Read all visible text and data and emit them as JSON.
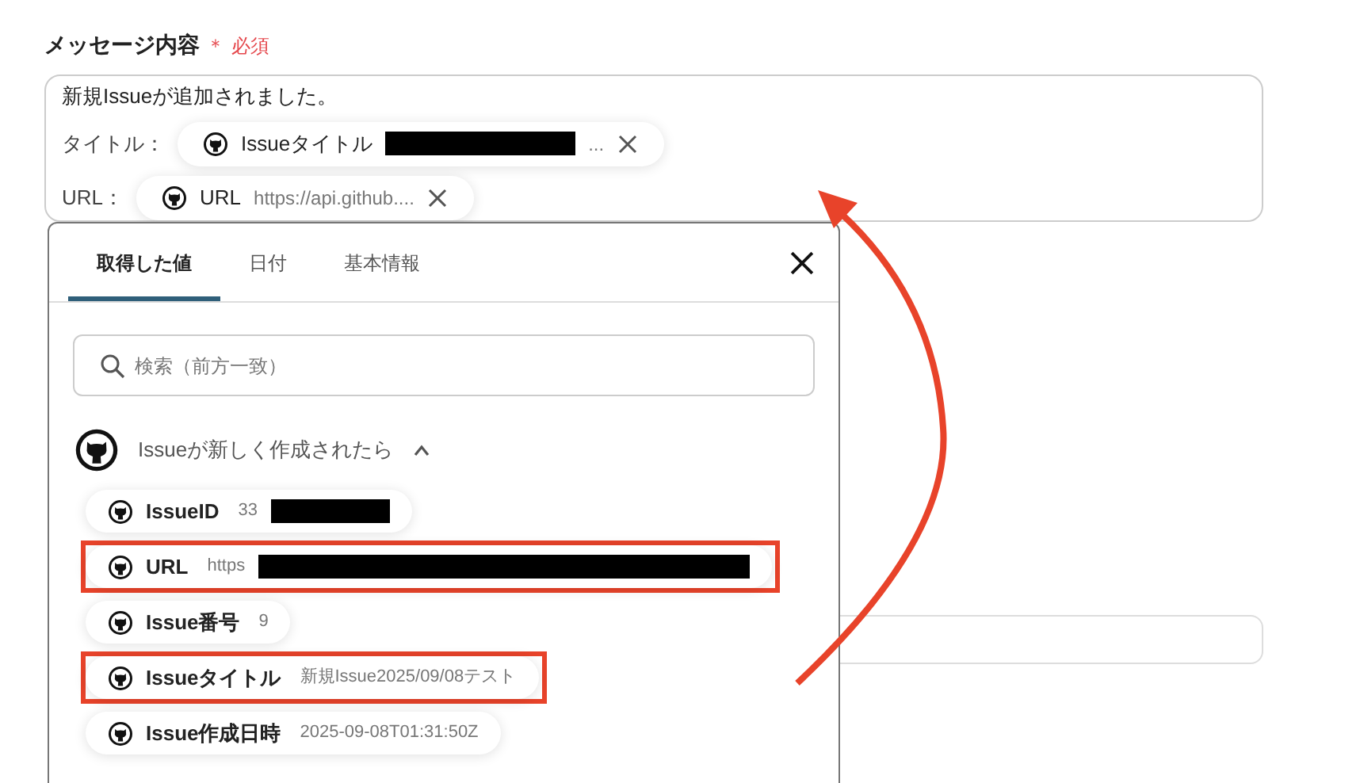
{
  "field": {
    "label": "メッセージ内容",
    "required_mark": "＊",
    "required_text": "必須"
  },
  "message": {
    "first_line": "新規Issueが追加されました。",
    "lines": [
      {
        "label": "タイトル：",
        "chip_name": "Issueタイトル",
        "chip_value": "...",
        "redacted": true
      },
      {
        "label": "URL：",
        "chip_name": "URL",
        "chip_value": "https://api.github....",
        "redacted": false
      }
    ]
  },
  "popup": {
    "tabs": [
      {
        "label": "取得した値",
        "selected": true
      },
      {
        "label": "日付",
        "selected": false
      },
      {
        "label": "基本情報",
        "selected": false
      }
    ],
    "search": {
      "placeholder": "検索（前方一致）"
    },
    "group": {
      "title": "Issueが新しく作成されたら",
      "expanded": true
    },
    "items": [
      {
        "name": "IssueID",
        "value": "33",
        "redacted": true,
        "highlighted": false
      },
      {
        "name": "URL",
        "value": "https",
        "redacted": true,
        "highlighted": true
      },
      {
        "name": "Issue番号",
        "value": "9",
        "redacted": false,
        "highlighted": false
      },
      {
        "name": "Issueタイトル",
        "value": "新規Issue2025/09/08テスト",
        "redacted": false,
        "highlighted": true
      },
      {
        "name": "Issue作成日時",
        "value": "2025-09-08T01:31:50Z",
        "redacted": false,
        "highlighted": false
      }
    ]
  }
}
